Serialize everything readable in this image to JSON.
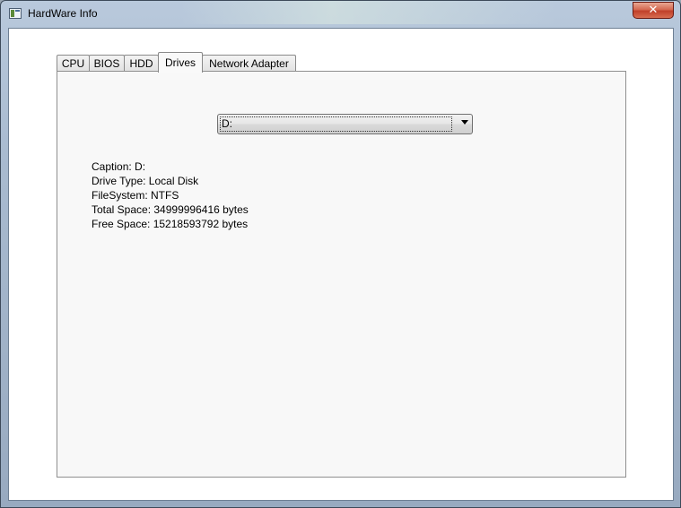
{
  "window": {
    "title": "HardWare Info",
    "close_label": "✕"
  },
  "tabs": [
    {
      "label": "CPU"
    },
    {
      "label": "BIOS"
    },
    {
      "label": "HDD"
    },
    {
      "label": "Drives",
      "active": true
    },
    {
      "label": "Network Adapter"
    }
  ],
  "drive_selector": {
    "value": "D:"
  },
  "drive_info": {
    "caption": "Caption: D:",
    "drive_type": "Drive Type: Local Disk",
    "file_system": "FileSystem: NTFS",
    "total_space": "Total Space: 34999996416 bytes",
    "free_space": "Free Space: 15218593792 bytes"
  },
  "colors": {
    "frame": "#a9bbd0",
    "close_button": "#c0402a",
    "panel_background": "#f8f8f8"
  }
}
